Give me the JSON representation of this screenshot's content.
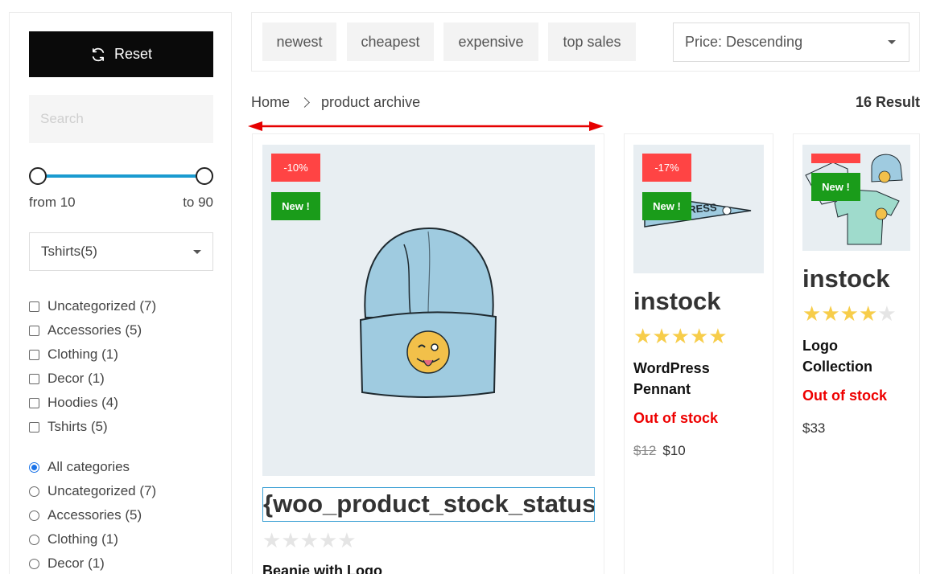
{
  "sidebar": {
    "reset_label": "Reset",
    "search_placeholder": "Search",
    "range": {
      "from_label": "from 10",
      "to_label": "to 90",
      "min_fraction": 0,
      "max_fraction": 1
    },
    "category_select": "Tshirts(5)",
    "checkboxes": [
      {
        "label": "Uncategorized (7)"
      },
      {
        "label": "Accessories (5)"
      },
      {
        "label": "Clothing (1)"
      },
      {
        "label": "Decor (1)"
      },
      {
        "label": "Hoodies (4)"
      },
      {
        "label": "Tshirts (5)"
      }
    ],
    "radios": [
      {
        "label": "All categories",
        "checked": true
      },
      {
        "label": "Uncategorized (7)"
      },
      {
        "label": "Accessories (5)"
      },
      {
        "label": "Clothing (1)"
      },
      {
        "label": "Decor (1)"
      }
    ]
  },
  "sortbar": {
    "buttons": [
      "newest",
      "cheapest",
      "expensive",
      "top sales"
    ],
    "order_value": "Price: Descending"
  },
  "breadcrumb": {
    "home": "Home",
    "current": "product archive"
  },
  "result_count": "16 Result",
  "colors": {
    "accent": "#1a9bd0",
    "sale": "#ff4444",
    "new": "#1a9c1a",
    "out_of_stock": "#ee0000",
    "star": "#f7cd4a",
    "annotation_arrow": "#e60000"
  },
  "products": [
    {
      "sale_badge": "-10%",
      "new_badge": "New !",
      "stock_title": "{woo_product_stock_status}",
      "rating": 0,
      "name": "Beanie with Logo"
    },
    {
      "sale_badge": "-17%",
      "new_badge": "New !",
      "stock_title": "instock",
      "rating": 5,
      "name_line1": "WordPress",
      "name_line2": "Pennant",
      "stock_status": "Out of stock",
      "old_price": "$12",
      "price": "$10"
    },
    {
      "sale_badge": "",
      "new_badge": "New !",
      "stock_title": "instock",
      "rating": 4,
      "name_line1": "Logo",
      "name_line2": "Collection",
      "stock_status": "Out of stock",
      "price": "$33"
    }
  ]
}
